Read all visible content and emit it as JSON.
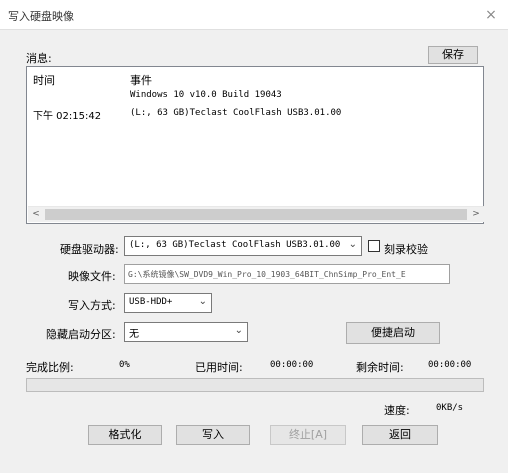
{
  "window": {
    "title": "写入硬盘映像",
    "close_glyph": "×"
  },
  "messages": {
    "label": "消息:",
    "save_label": "保存",
    "col_time": "时间",
    "col_event": "事件",
    "rows": [
      {
        "time": "",
        "event": "Windows 10 v10.0 Build 19043"
      },
      {
        "time": "下午 02:15:42",
        "event": "(L:, 63 GB)Teclast CoolFlash USB3.01.00"
      }
    ],
    "scroll_left": "<",
    "scroll_right": ">"
  },
  "form": {
    "drive_label": "硬盘驱动器:",
    "drive_value": "(L:, 63 GB)Teclast CoolFlash USB3.01.00",
    "verify_label": "刻录校验",
    "verify_checked": false,
    "image_label": "映像文件:",
    "image_value": "G:\\系统镜像\\SW_DVD9_Win_Pro_10_1903_64BIT_ChnSimp_Pro_Ent_E",
    "write_label": "写入方式:",
    "write_value": "USB-HDD+",
    "hidden_label": "隐藏启动分区:",
    "hidden_value": "无",
    "quick_boot_label": "便捷启动"
  },
  "status": {
    "complete_label": "完成比例:",
    "complete_value": "0%",
    "progress_fraction": 0,
    "elapsed_label": "已用时间:",
    "elapsed_value": "00:00:00",
    "remaining_label": "剩余时间:",
    "remaining_value": "00:00:00",
    "speed_label": "速度:",
    "speed_value": "0KB/s"
  },
  "actions": {
    "format_label": "格式化",
    "write_label": "写入",
    "stop_label": "终止[A]",
    "back_label": "返回"
  },
  "colors": {
    "progress_fill": "#06b025"
  }
}
